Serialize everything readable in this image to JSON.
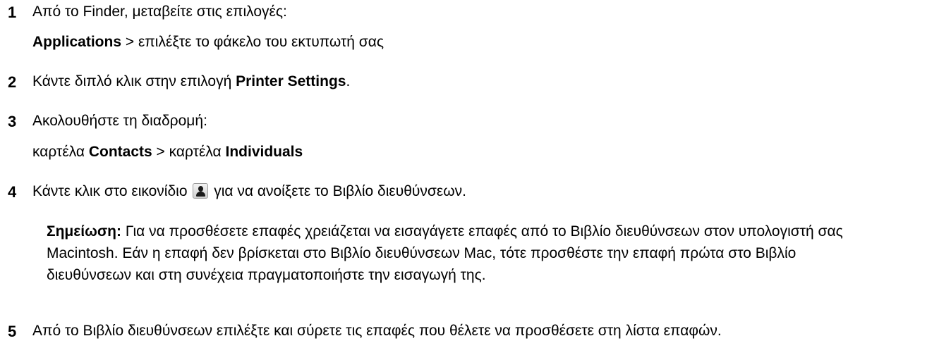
{
  "steps": [
    {
      "number": "1",
      "lines": [
        {
          "text": "Από το Finder, μεταβείτε στις επιλογές:"
        },
        {
          "bold": "Applications",
          "after": " > επιλέξτε το φάκελο του εκτυπωτή σας"
        }
      ]
    },
    {
      "number": "2",
      "before": "Κάντε διπλό κλικ στην επιλογή ",
      "bold": "Printer Settings",
      "after": "."
    },
    {
      "number": "3",
      "lines": [
        {
          "text": "Ακολουθήστε τη διαδρομή:"
        },
        {
          "before": "καρτέλα ",
          "bold1": "Contacts",
          "middle": " > καρτέλα ",
          "bold2": "Individuals"
        }
      ]
    },
    {
      "number": "4",
      "before": "Κάντε κλικ στο εικονίδιο",
      "icon": "address-book-person-icon",
      "after": "για να ανοίξετε το Βιβλίο διευθύνσεων."
    },
    {
      "number": "5",
      "text": "Από το Βιβλίο διευθύνσεων επιλέξτε και σύρετε τις επαφές που θέλετε να προσθέσετε στη λίστα επαφών."
    }
  ],
  "note": {
    "label": "Σημείωση:",
    "text": " Για να προσθέσετε επαφές χρειάζεται να εισαγάγετε επαφές από το Βιβλίο διευθύνσεων στον υπολογιστή σας Macintosh. Εάν η επαφή δεν βρίσκεται στο Βιβλίο διευθύνσεων Mac, τότε προσθέστε την επαφή πρώτα στο Βιβλίο διευθύνσεων και στη συνέχεια πραγματοποιήστε την εισαγωγή της."
  }
}
